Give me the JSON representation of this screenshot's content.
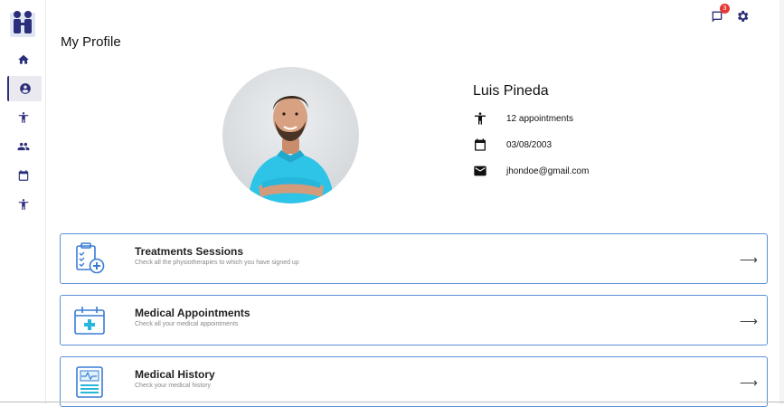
{
  "app": {
    "brand_color": "#2b2e7a",
    "accent_border": "#5b8fd6",
    "badge_color": "#e53935"
  },
  "sidebar": {
    "items": [
      {
        "icon": "home-icon"
      },
      {
        "icon": "account-icon",
        "active": true
      },
      {
        "icon": "accessibility-icon"
      },
      {
        "icon": "group-icon"
      },
      {
        "icon": "calendar-icon"
      },
      {
        "icon": "accessibility-icon"
      }
    ]
  },
  "topbar": {
    "notifications_count": "3",
    "notifications_icon": "notifications-icon",
    "settings_icon": "gear-icon"
  },
  "page": {
    "title": "My Profile"
  },
  "profile": {
    "name": "Luis Pineda",
    "appointments": "12 appointments",
    "birthdate": "03/08/2003",
    "email": "jhondoe@gmail.com"
  },
  "cards": [
    {
      "title": "Treatments Sessions",
      "subtitle": "Check all the physiotherapies to which you have signed up",
      "icon": "clipboard-plus-icon"
    },
    {
      "title": "Medical Appointments",
      "subtitle": "Check all your medical appointments",
      "icon": "calendar-plus-icon"
    },
    {
      "title": "Medical History",
      "subtitle": "Check your medical history",
      "icon": "medical-record-icon"
    }
  ]
}
